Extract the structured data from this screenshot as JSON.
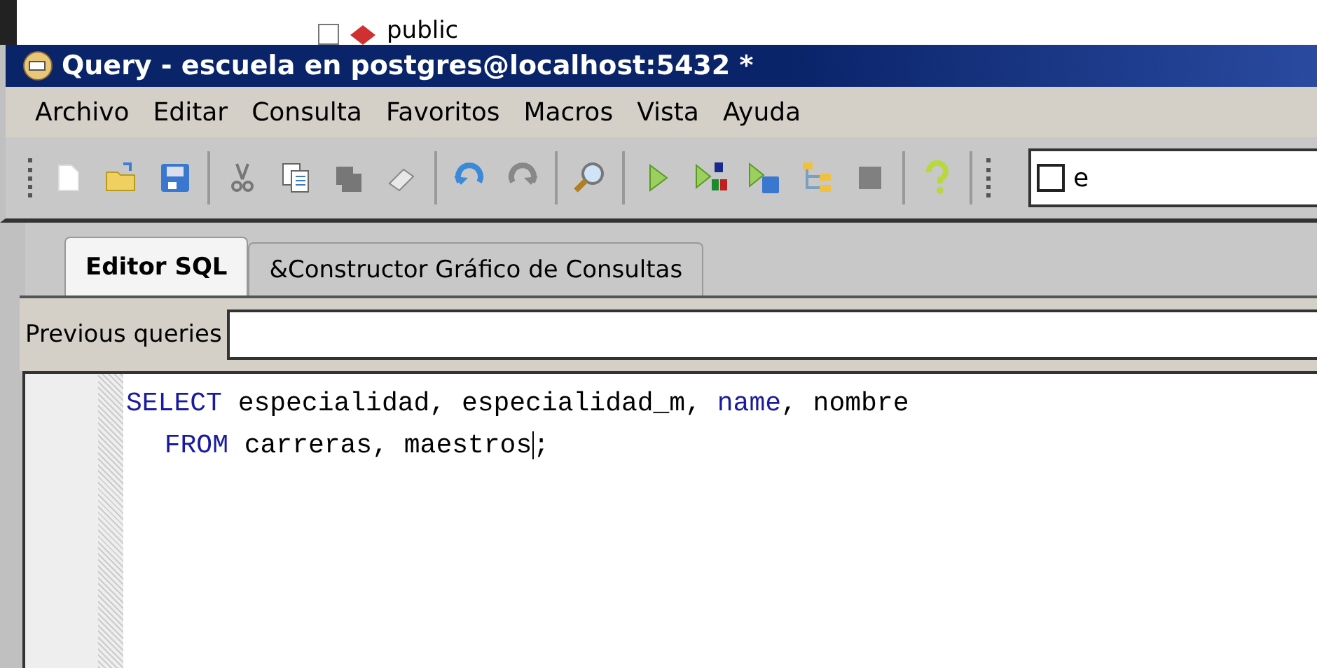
{
  "tree_fragment": {
    "label": "public",
    "checked": false
  },
  "window": {
    "title": "Query - escuela en postgres@localhost:5432 *"
  },
  "menu": [
    "Archivo",
    "Editar",
    "Consulta",
    "Favoritos",
    "Macros",
    "Vista",
    "Ayuda"
  ],
  "toolbar_checkbox": {
    "label": "e",
    "checked": false
  },
  "tabs": [
    {
      "label": "Editor SQL",
      "selected": true
    },
    {
      "label": "&Constructor Gráfico de Consultas",
      "selected": false
    }
  ],
  "previous_queries": {
    "label": "Previous queries"
  },
  "editor": {
    "lines": [
      [
        {
          "kind": "keyword",
          "text": "SELECT"
        },
        {
          "kind": "plain",
          "text": " especialidad, especialidad_m, "
        },
        {
          "kind": "keyword",
          "text": "name"
        },
        {
          "kind": "plain",
          "text": ", nombre"
        }
      ],
      [
        {
          "kind": "indent"
        },
        {
          "kind": "keyword",
          "text": "FROM"
        },
        {
          "kind": "plain",
          "text": " carreras, maestros"
        },
        {
          "kind": "cursor"
        },
        {
          "kind": "plain",
          "text": ";"
        }
      ]
    ]
  }
}
